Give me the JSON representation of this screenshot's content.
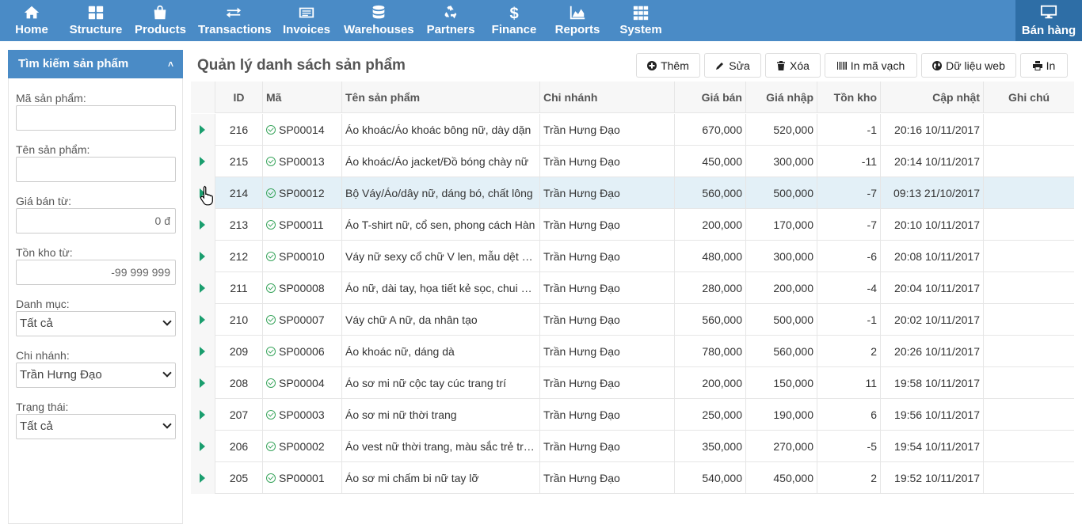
{
  "nav": {
    "items": [
      {
        "label": "Home",
        "icon": "home-icon"
      },
      {
        "label": "Structure",
        "icon": "grid-icon"
      },
      {
        "label": "Products",
        "icon": "shopping-bag-icon"
      },
      {
        "label": "Transactions",
        "icon": "exchange-icon"
      },
      {
        "label": "Invoices",
        "icon": "invoice-icon"
      },
      {
        "label": "Warehouses",
        "icon": "database-icon"
      },
      {
        "label": "Partners",
        "icon": "recycle-icon"
      },
      {
        "label": "Finance",
        "icon": "dollar-icon"
      },
      {
        "label": "Reports",
        "icon": "area-chart-icon"
      },
      {
        "label": "System",
        "icon": "th-icon"
      }
    ],
    "sales": {
      "label": "Bán hàng",
      "icon": "monitor-icon"
    }
  },
  "sidebar": {
    "title": "Tìm kiếm sản phẩm",
    "product_code_label": "Mã sản phẩm:",
    "product_code_value": "",
    "product_name_label": "Tên sản phẩm:",
    "product_name_value": "",
    "price_from_label": "Giá bán từ:",
    "price_from_value": "0 đ",
    "stock_from_label": "Tồn kho từ:",
    "stock_from_value": "-99 999 999",
    "category_label": "Danh mục:",
    "category_value": "Tất cả",
    "branch_label": "Chi nhánh:",
    "branch_value": "Trần Hưng Đạo",
    "status_label": "Trạng thái:",
    "status_value": "Tất cả"
  },
  "main": {
    "title": "Quản lý danh sách sản phẩm",
    "toolbar": {
      "add": "Thêm",
      "edit": "Sửa",
      "delete": "Xóa",
      "barcode": "In mã vạch",
      "web": "Dữ liệu web",
      "print": "In"
    },
    "columns": {
      "id": "ID",
      "code": "Mã",
      "name": "Tên sản phẩm",
      "branch": "Chi nhánh",
      "price": "Giá bán",
      "cost": "Giá nhập",
      "stock": "Tồn kho",
      "updated": "Cập nhật",
      "note": "Ghi chú"
    },
    "rows": [
      {
        "id": "216",
        "code": "SP00014",
        "name": "Áo khoác/Áo khoác bông nữ, dày dặn",
        "branch": "Trần Hưng Đạo",
        "price": "670,000",
        "cost": "520,000",
        "stock": "-1",
        "updated": "20:16 10/11/2017",
        "note": ""
      },
      {
        "id": "215",
        "code": "SP00013",
        "name": "Áo khoác/Áo jacket/Đồ bóng chày nữ",
        "branch": "Trần Hưng Đạo",
        "price": "450,000",
        "cost": "300,000",
        "stock": "-11",
        "updated": "20:14 10/11/2017",
        "note": ""
      },
      {
        "id": "214",
        "code": "SP00012",
        "name": "Bộ Váy/Áo/dây nữ, dáng bó, chất lông",
        "branch": "Trần Hưng Đạo",
        "price": "560,000",
        "cost": "500,000",
        "stock": "-7",
        "updated": "09:13 21/10/2017",
        "note": ""
      },
      {
        "id": "213",
        "code": "SP00011",
        "name": "Áo T-shirt nữ, cổ sen, phong cách Hàn",
        "branch": "Trần Hưng Đạo",
        "price": "200,000",
        "cost": "170,000",
        "stock": "-7",
        "updated": "20:10 10/11/2017",
        "note": ""
      },
      {
        "id": "212",
        "code": "SP00010",
        "name": "Váy nữ sexy cổ chữ V len, mẫu dệt kim",
        "branch": "Trần Hưng Đạo",
        "price": "480,000",
        "cost": "300,000",
        "stock": "-6",
        "updated": "20:08 10/11/2017",
        "note": ""
      },
      {
        "id": "211",
        "code": "SP00008",
        "name": "Áo nữ, dài tay, họa tiết kẻ sọc, chui đầu",
        "branch": "Trần Hưng Đạo",
        "price": "280,000",
        "cost": "200,000",
        "stock": "-4",
        "updated": "20:04 10/11/2017",
        "note": ""
      },
      {
        "id": "210",
        "code": "SP00007",
        "name": "Váy chữ A nữ, da nhân tạo",
        "branch": "Trần Hưng Đạo",
        "price": "560,000",
        "cost": "500,000",
        "stock": "-1",
        "updated": "20:02 10/11/2017",
        "note": ""
      },
      {
        "id": "209",
        "code": "SP00006",
        "name": "Áo khoác nữ, dáng dà",
        "branch": "Trần Hưng Đạo",
        "price": "780,000",
        "cost": "560,000",
        "stock": "2",
        "updated": "20:26 10/11/2017",
        "note": ""
      },
      {
        "id": "208",
        "code": "SP00004",
        "name": "Áo sơ mi nữ cộc tay cúc trang trí",
        "branch": "Trần Hưng Đạo",
        "price": "200,000",
        "cost": "150,000",
        "stock": "11",
        "updated": "19:58 10/11/2017",
        "note": ""
      },
      {
        "id": "207",
        "code": "SP00003",
        "name": "Áo sơ mi nữ thời trang",
        "branch": "Trần Hưng Đạo",
        "price": "250,000",
        "cost": "190,000",
        "stock": "6",
        "updated": "19:56 10/11/2017",
        "note": ""
      },
      {
        "id": "206",
        "code": "SP00002",
        "name": "Áo vest nữ thời trang, màu sắc trẻ trung",
        "branch": "Trần Hưng Đạo",
        "price": "350,000",
        "cost": "270,000",
        "stock": "-5",
        "updated": "19:54 10/11/2017",
        "note": ""
      },
      {
        "id": "205",
        "code": "SP00001",
        "name": "Áo sơ mi chấm bi nữ tay lỡ",
        "branch": "Trần Hưng Đạo",
        "price": "540,000",
        "cost": "450,000",
        "stock": "2",
        "updated": "19:52 10/11/2017",
        "note": ""
      }
    ]
  },
  "colors": {
    "nav_bg": "#4a8bc6",
    "nav_sales_bg": "#2e6ea6",
    "row_selected": "#e3f0f7",
    "status_ok": "#3aa55d",
    "expander": "#1a9e6e"
  }
}
